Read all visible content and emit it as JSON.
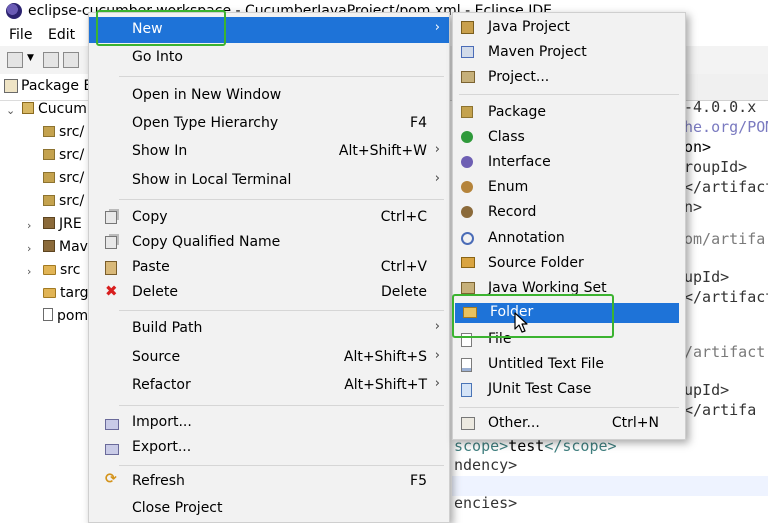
{
  "window": {
    "title": "eclipse-cucumber-workspace - CucumberJavaProject/pom.xml - Eclipse IDE"
  },
  "menubar": {
    "items": [
      "File",
      "Edit"
    ]
  },
  "package_explorer": {
    "title": "Package E",
    "tree": [
      {
        "label": "Cucum",
        "icon": "project-icon"
      },
      {
        "label": "src/",
        "icon": "package-folder-icon"
      },
      {
        "label": "src/",
        "icon": "package-folder-icon"
      },
      {
        "label": "src/",
        "icon": "package-folder-icon"
      },
      {
        "label": "src/",
        "icon": "package-folder-icon"
      },
      {
        "label": "JRE",
        "icon": "library-icon"
      },
      {
        "label": "Mav",
        "icon": "library-icon"
      },
      {
        "label": "src",
        "icon": "folder-icon"
      },
      {
        "label": "targ",
        "icon": "folder-icon"
      },
      {
        "label": "pom",
        "icon": "file-icon"
      }
    ]
  },
  "editor": {
    "lines": [
      "-4.0.0.x",
      "he.org/POM",
      "on>",
      "roupId>",
      "</artifact",
      "n>",
      "",
      "om/artifa",
      "",
      "upId>",
      "</artifact",
      "",
      "",
      "/artifact",
      "",
      "upId>",
      "</artifa"
    ],
    "bottom": {
      "scope_open": "scope>",
      "scope_value": "test",
      "scope_close": "</scope>",
      "line2": "ndency>",
      "line4": "encies>"
    }
  },
  "context_menu": {
    "items": [
      {
        "label": "New",
        "submenu": true,
        "selected": true
      },
      {
        "label": "Go Into"
      },
      {
        "label": "Open in New Window"
      },
      {
        "label": "Open Type Hierarchy",
        "shortcut": "F4"
      },
      {
        "label": "Show In",
        "shortcut": "Alt+Shift+W",
        "submenu": true
      },
      {
        "label": "Show in Local Terminal",
        "submenu": true
      },
      {
        "label": "Copy",
        "shortcut": "Ctrl+C",
        "icon": "copy-icon"
      },
      {
        "label": "Copy Qualified Name",
        "icon": "copy-qualified-icon"
      },
      {
        "label": "Paste",
        "shortcut": "Ctrl+V",
        "icon": "paste-icon"
      },
      {
        "label": "Delete",
        "shortcut": "Delete",
        "icon": "delete-icon"
      },
      {
        "label": "Build Path",
        "submenu": true
      },
      {
        "label": "Source",
        "shortcut": "Alt+Shift+S",
        "submenu": true
      },
      {
        "label": "Refactor",
        "shortcut": "Alt+Shift+T",
        "submenu": true
      },
      {
        "label": "Import...",
        "icon": "import-icon"
      },
      {
        "label": "Export...",
        "icon": "export-icon"
      },
      {
        "label": "Refresh",
        "shortcut": "F5",
        "icon": "refresh-icon"
      },
      {
        "label": "Close Project"
      }
    ]
  },
  "new_submenu": {
    "items": [
      {
        "label": "Java Project",
        "icon": "java-project-icon"
      },
      {
        "label": "Maven Project",
        "icon": "maven-project-icon"
      },
      {
        "label": "Project...",
        "icon": "project-icon"
      },
      {
        "label": "Package",
        "icon": "package-icon"
      },
      {
        "label": "Class",
        "icon": "class-icon"
      },
      {
        "label": "Interface",
        "icon": "interface-icon"
      },
      {
        "label": "Enum",
        "icon": "enum-icon"
      },
      {
        "label": "Record",
        "icon": "record-icon"
      },
      {
        "label": "Annotation",
        "icon": "annotation-icon"
      },
      {
        "label": "Source Folder",
        "icon": "source-folder-icon"
      },
      {
        "label": "Java Working Set",
        "icon": "working-set-icon"
      },
      {
        "label": "Folder",
        "icon": "folder-icon",
        "selected": true
      },
      {
        "label": "File",
        "icon": "file-icon"
      },
      {
        "label": "Untitled Text File",
        "icon": "text-file-icon"
      },
      {
        "label": "JUnit Test Case",
        "icon": "junit-icon"
      },
      {
        "label": "Other...",
        "shortcut": "Ctrl+N",
        "icon": "other-wizard-icon"
      }
    ]
  },
  "colors": {
    "selection": "#1e73d8",
    "highlight_box": "#3bb330",
    "menu_bg": "#f2f2f2"
  }
}
